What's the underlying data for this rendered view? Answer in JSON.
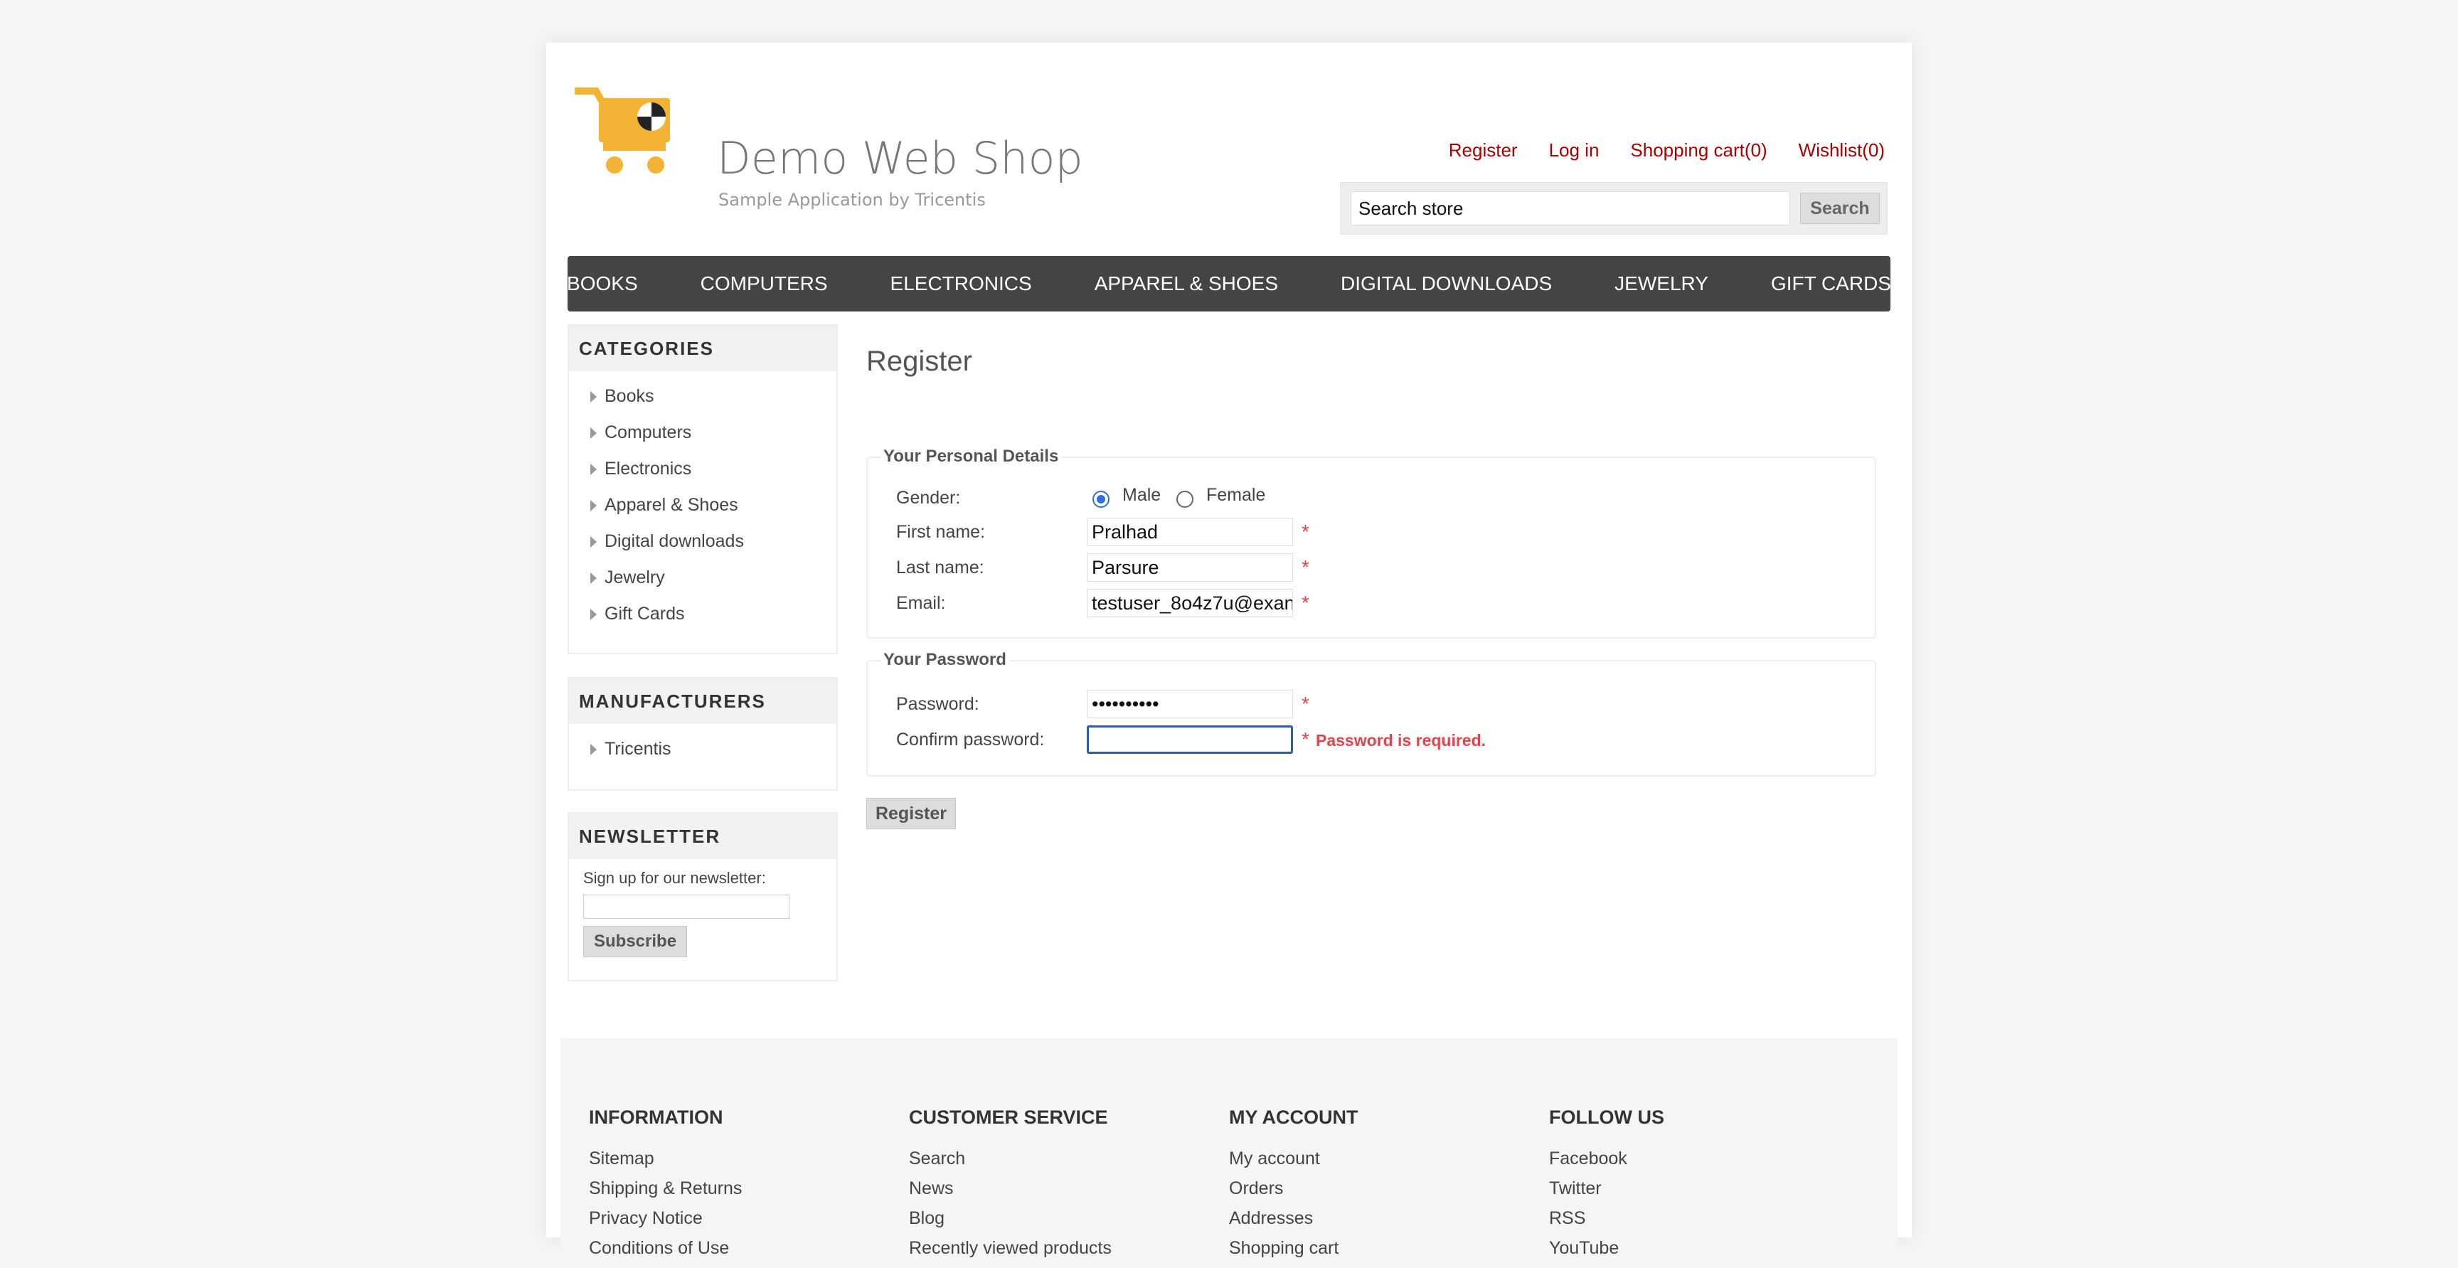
{
  "header": {
    "logo_title": "Demo Web Shop",
    "logo_subtitle": "Sample Application by Tricentis",
    "links": {
      "register": "Register",
      "login": "Log in",
      "cart": "Shopping cart(0)",
      "wishlist": "Wishlist(0)"
    },
    "search": {
      "value": "Search store",
      "button": "Search"
    }
  },
  "top_menu": [
    "BOOKS",
    "COMPUTERS",
    "ELECTRONICS",
    "APPAREL & SHOES",
    "DIGITAL DOWNLOADS",
    "JEWELRY",
    "GIFT CARDS"
  ],
  "sidebar": {
    "categories": {
      "title": "CATEGORIES",
      "items": [
        "Books",
        "Computers",
        "Electronics",
        "Apparel & Shoes",
        "Digital downloads",
        "Jewelry",
        "Gift Cards"
      ]
    },
    "manufacturers": {
      "title": "MANUFACTURERS",
      "items": [
        "Tricentis"
      ]
    },
    "newsletter": {
      "title": "NEWSLETTER",
      "label": "Sign up for our newsletter:",
      "value": "",
      "button": "Subscribe"
    }
  },
  "main": {
    "title": "Register",
    "personal": {
      "legend": "Your Personal Details",
      "gender_label": "Gender:",
      "male": "Male",
      "female": "Female",
      "first_name_label": "First name:",
      "first_name": "Pralhad",
      "last_name_label": "Last name:",
      "last_name": "Parsure",
      "email_label": "Email:",
      "email": "testuser_8o4z7u@exan"
    },
    "password": {
      "legend": "Your Password",
      "password_label": "Password:",
      "password_value": "••••••••••",
      "confirm_label": "Confirm password:",
      "confirm_value": "",
      "error": "Password is required."
    },
    "required_mark": "*",
    "register_button": "Register"
  },
  "footer": {
    "columns": [
      {
        "title": "INFORMATION",
        "links": [
          "Sitemap",
          "Shipping & Returns",
          "Privacy Notice",
          "Conditions of Use"
        ]
      },
      {
        "title": "CUSTOMER SERVICE",
        "links": [
          "Search",
          "News",
          "Blog",
          "Recently viewed products"
        ]
      },
      {
        "title": "MY ACCOUNT",
        "links": [
          "My account",
          "Orders",
          "Addresses",
          "Shopping cart"
        ]
      },
      {
        "title": "FOLLOW US",
        "links": [
          "Facebook",
          "Twitter",
          "RSS",
          "YouTube"
        ]
      }
    ]
  },
  "colors": {
    "link_red": "#aa0000",
    "menu_bg": "#444444",
    "error_red": "#e4434b",
    "focus_blue": "#2a5db0",
    "logo_orange": "#f5b335"
  }
}
